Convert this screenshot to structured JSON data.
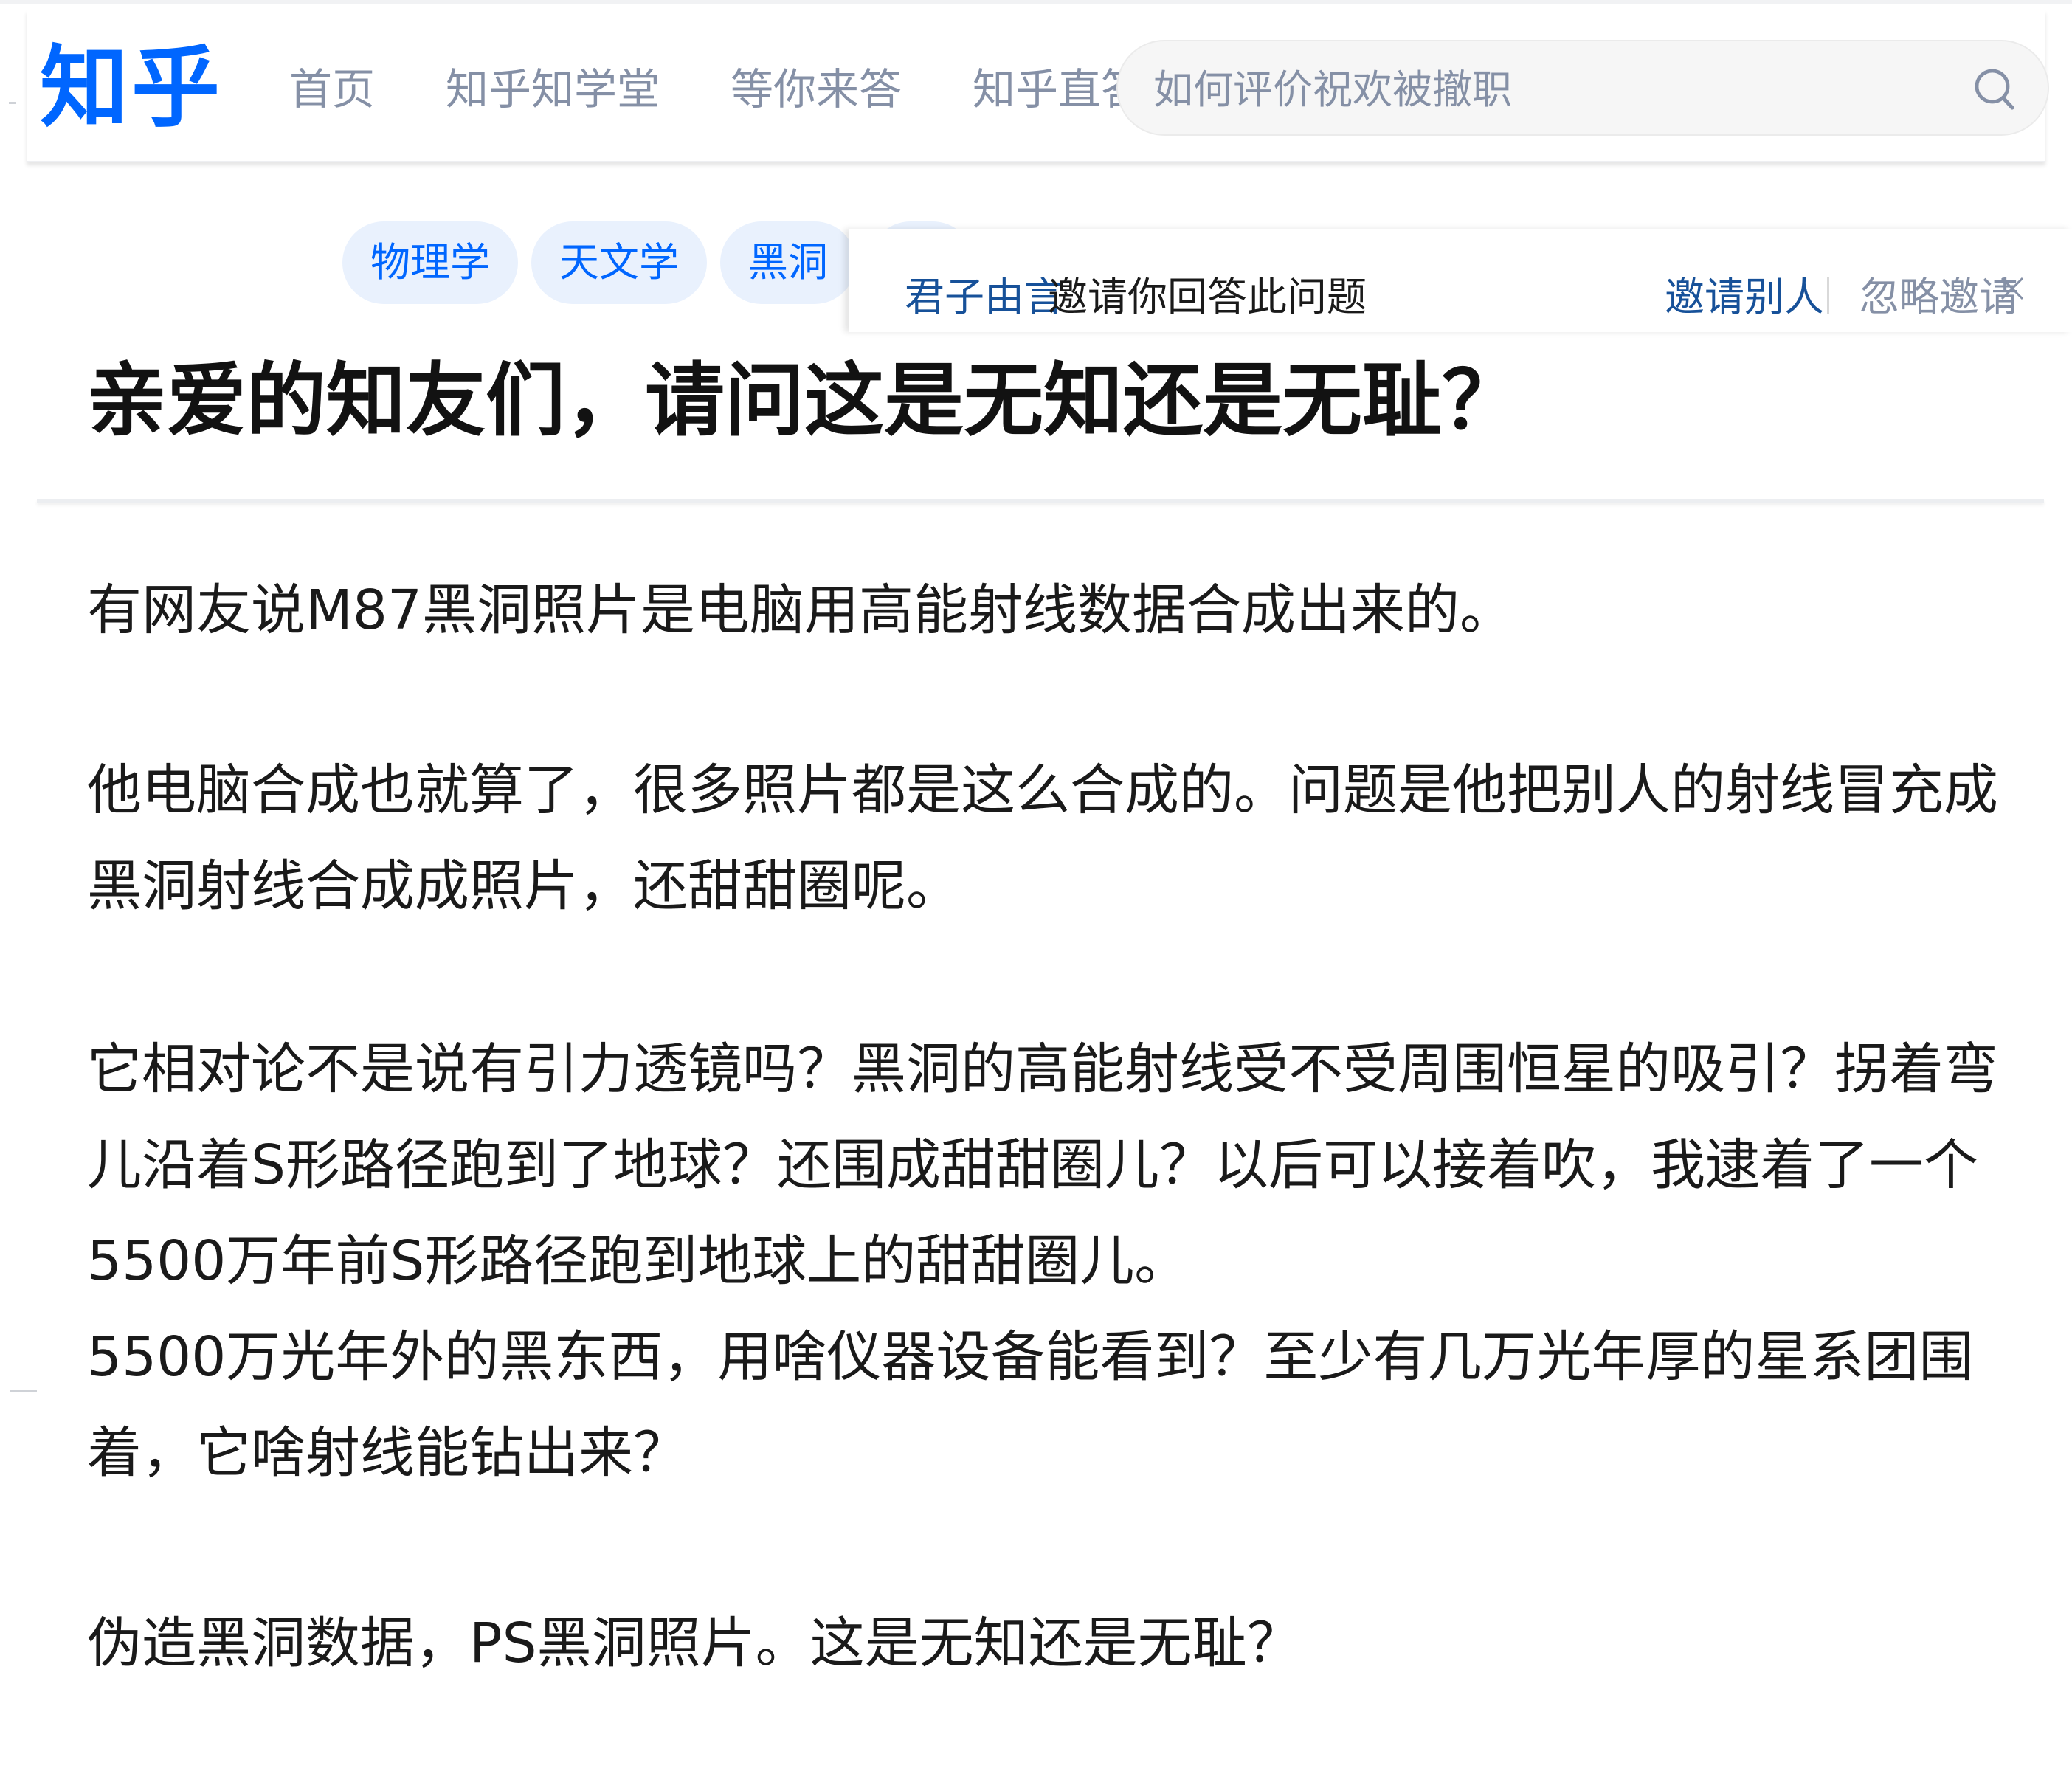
{
  "brand": {
    "logo_text": "知乎",
    "accent": "#0066ff"
  },
  "nav": {
    "items": [
      "首页",
      "知乎知学堂",
      "等你来答",
      "知乎直答"
    ]
  },
  "search": {
    "placeholder": "如何评价祝欢被撤职"
  },
  "topics": [
    "物理学",
    "天文学",
    "黑洞"
  ],
  "invite": {
    "inviter": "君子由言",
    "text": "邀请你回答此问题",
    "invite_others": "邀请别人",
    "ignore": "忽略邀请"
  },
  "question": {
    "title": "亲爱的知友们，请问这是无知还是无耻？",
    "paragraphs": [
      "有网友说M87黑洞照片是电脑用高能射线数据合成出来的。",
      "他电脑合成也就算了，很多照片都是这么合成的。问题是他把别人的射线冒充成黑洞射线合成成照片，还甜甜圈呢。",
      "它相对论不是说有引力透镜吗？黑洞的高能射线受不受周围恒星的吸引？拐着弯儿沿着S形路径跑到了地球？还围成甜甜圈儿？以后可以接着吹，我逮着了一个5500万年前S形路径跑到地球上的甜甜圈儿。",
      "5500万光年外的黑东西，用啥仪器设备能看到？至少有几万光年厚的星系团围着，它啥射线能钻出来？",
      "伪造黑洞数据，PS黑洞照片。这是无知还是无耻？"
    ]
  }
}
